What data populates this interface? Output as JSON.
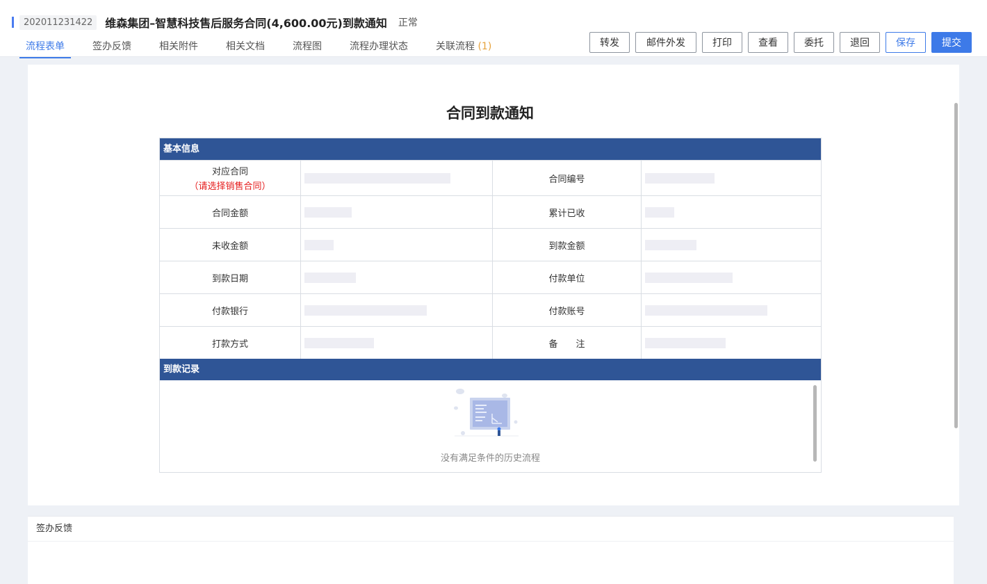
{
  "header": {
    "request_id": "202011231422",
    "title": "维森集团–智慧科技售后服务合同(4,600.00元)到款通知",
    "status": "正常"
  },
  "tabs": [
    {
      "label": "流程表单",
      "active": true
    },
    {
      "label": "签办反馈"
    },
    {
      "label": "相关附件"
    },
    {
      "label": "相关文档"
    },
    {
      "label": "流程图"
    },
    {
      "label": "流程办理状态"
    },
    {
      "label": "关联流程",
      "count": "(1)"
    }
  ],
  "actions": {
    "forward": "转发",
    "email_out": "邮件外发",
    "print": "打印",
    "view": "查看",
    "entrust": "委托",
    "return": "退回",
    "save": "保存",
    "submit": "提交"
  },
  "form": {
    "title": "合同到款通知",
    "section_basic": "基本信息",
    "section_records": "到款记录",
    "required_hint": "（请选择销售合同）",
    "rows": [
      {
        "l1": "对应合同",
        "l2": "合同编号"
      },
      {
        "l1": "合同金额",
        "l2": "累计已收"
      },
      {
        "l1": "未收金额",
        "l2": "到款金额"
      },
      {
        "l1": "到款日期",
        "l2": "付款单位"
      },
      {
        "l1": "付款银行",
        "l2": "付款账号"
      },
      {
        "l1": "打款方式",
        "l2": "备　　注"
      }
    ],
    "empty_text": "没有满足条件的历史流程"
  },
  "feedback_panel": {
    "title": "签办反馈"
  },
  "colors": {
    "accent": "#3d7ae8",
    "section_header": "#2f5596",
    "required": "#e51c1c",
    "tab_count": "#e6a23c"
  }
}
